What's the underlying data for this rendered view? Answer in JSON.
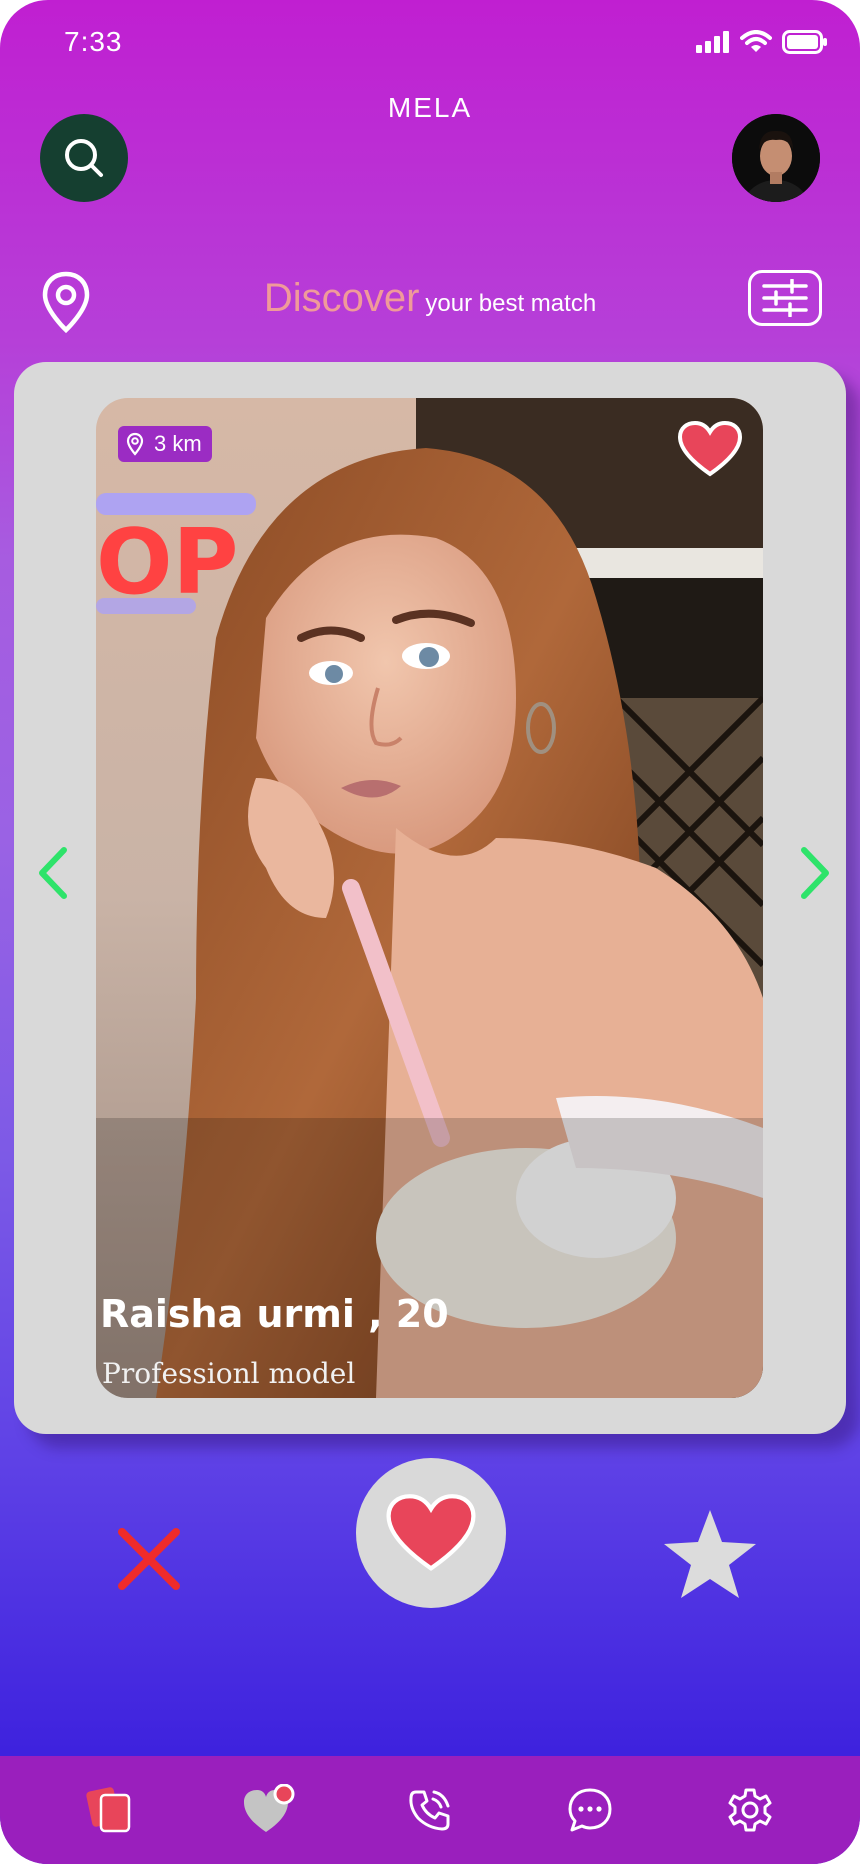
{
  "status_bar": {
    "time": "7:33"
  },
  "app": {
    "brand": "MELA"
  },
  "header": {
    "discover_word": "Discover",
    "discover_tagline": "your best match"
  },
  "profile_card": {
    "distance": "3 km",
    "name_age": "Raisha urmi , 20",
    "occupation": "Professionl model"
  },
  "actions": [
    "dislike",
    "like",
    "super-like"
  ],
  "bottom_nav": [
    "cards-icon",
    "likes-icon",
    "calls-icon",
    "chat-icon",
    "settings-icon"
  ],
  "colors": {
    "gradient_top": "#c01fd1",
    "gradient_bottom": "#3a1fdb",
    "accent_heart": "#e8455a",
    "nav_bar": "#9a1fbd",
    "search_button": "#153f30",
    "arrow_green": "#2ee36a",
    "discover_pink": "#f09a9a"
  }
}
